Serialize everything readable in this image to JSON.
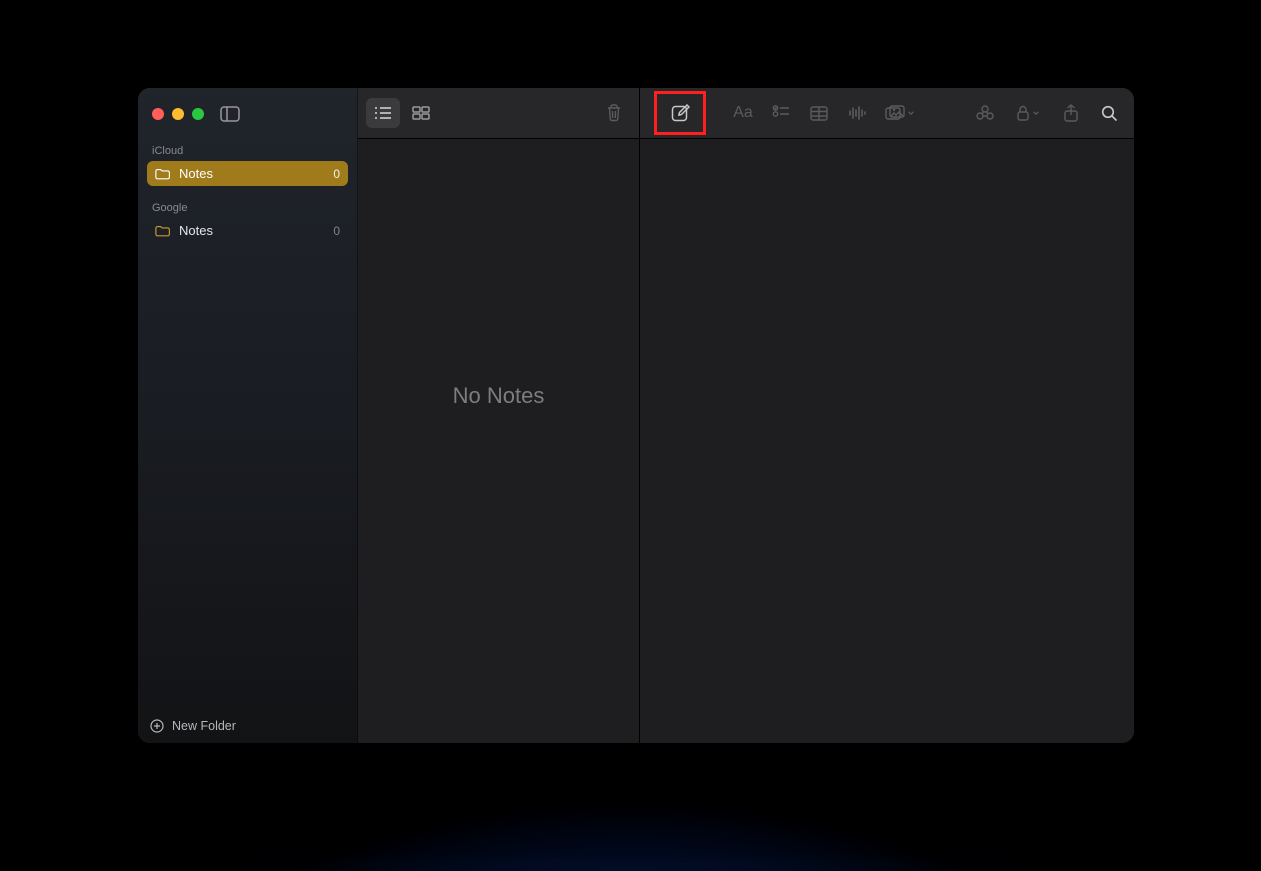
{
  "sidebar": {
    "sections": [
      {
        "label": "iCloud",
        "items": [
          {
            "name": "Notes",
            "count": "0",
            "selected": true
          }
        ]
      },
      {
        "label": "Google",
        "items": [
          {
            "name": "Notes",
            "count": "0",
            "selected": false
          }
        ]
      }
    ],
    "newFolder": "New Folder"
  },
  "middle": {
    "emptyText": "No Notes"
  },
  "toolbar": {
    "highlighted": "new-note"
  }
}
